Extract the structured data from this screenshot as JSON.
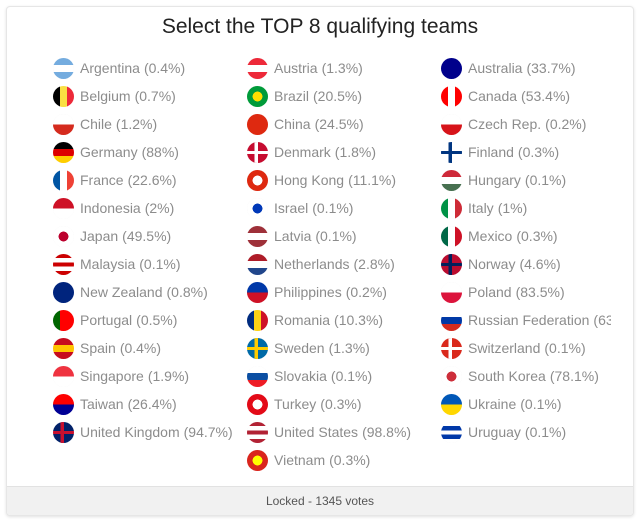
{
  "poll": {
    "title": "Select the TOP 8 qualifying teams",
    "footer": "Locked - 1345 votes"
  },
  "columns": [
    [
      {
        "name": "Argentina",
        "pct": "(0.4%)",
        "icon": "flag-argentina",
        "colors": [
          "#74acdf",
          "#ffffff",
          "#74acdf"
        ],
        "layout": "h"
      },
      {
        "name": "Belgium",
        "pct": "(0.7%)",
        "icon": "flag-belgium",
        "colors": [
          "#000000",
          "#fae042",
          "#ed2939"
        ],
        "layout": "v"
      },
      {
        "name": "Chile",
        "pct": "(1.2%)",
        "icon": "flag-chile",
        "colors": [
          "#ffffff",
          "#d52b1e"
        ],
        "layout": "h2"
      },
      {
        "name": "Germany",
        "pct": "(88%)",
        "icon": "flag-germany",
        "colors": [
          "#000000",
          "#dd0000",
          "#ffce00"
        ],
        "layout": "h"
      },
      {
        "name": "France",
        "pct": "(22.6%)",
        "icon": "flag-france",
        "colors": [
          "#0055a4",
          "#ffffff",
          "#ef4135"
        ],
        "layout": "v"
      },
      {
        "name": "Indonesia",
        "pct": "(2%)",
        "icon": "flag-indonesia",
        "colors": [
          "#ce1126",
          "#ffffff"
        ],
        "layout": "h2"
      },
      {
        "name": "Japan",
        "pct": "(49.5%)",
        "icon": "flag-japan",
        "colors": [
          "#ffffff",
          "#bc002d"
        ],
        "layout": "dot"
      },
      {
        "name": "Malaysia",
        "pct": "(0.1%)",
        "icon": "flag-malaysia",
        "colors": [
          "#cc0001",
          "#ffffff",
          "#cc0001",
          "#ffffff",
          "#cc0001"
        ],
        "layout": "h"
      },
      {
        "name": "New Zealand",
        "pct": "(0.8%)",
        "icon": "flag-new-zealand",
        "colors": [
          "#00247d",
          "#00247d"
        ],
        "layout": "h2"
      },
      {
        "name": "Portugal",
        "pct": "(0.5%)",
        "icon": "flag-portugal",
        "colors": [
          "#006600",
          "#ff0000",
          "#ff0000"
        ],
        "layout": "v"
      },
      {
        "name": "Spain",
        "pct": "(0.4%)",
        "icon": "flag-spain",
        "colors": [
          "#c60b1e",
          "#ffc400",
          "#c60b1e"
        ],
        "layout": "h"
      },
      {
        "name": "Singapore",
        "pct": "(1.9%)",
        "icon": "flag-singapore",
        "colors": [
          "#ef3340",
          "#ffffff"
        ],
        "layout": "h2"
      },
      {
        "name": "Taiwan",
        "pct": "(26.4%)",
        "icon": "flag-taiwan",
        "colors": [
          "#fe0000",
          "#000095"
        ],
        "layout": "h2"
      },
      {
        "name": "United Kingdom",
        "pct": "(94.7%)",
        "icon": "flag-united-kingdom",
        "colors": [
          "#012169",
          "#c8102e",
          "#012169"
        ],
        "layout": "cross"
      }
    ],
    [
      {
        "name": "Austria",
        "pct": "(1.3%)",
        "icon": "flag-austria",
        "colors": [
          "#ed2939",
          "#ffffff",
          "#ed2939"
        ],
        "layout": "h"
      },
      {
        "name": "Brazil",
        "pct": "(20.5%)",
        "icon": "flag-brazil",
        "colors": [
          "#009b3a",
          "#fedf00"
        ],
        "layout": "dot"
      },
      {
        "name": "China",
        "pct": "(24.5%)",
        "icon": "flag-china",
        "colors": [
          "#de2910",
          "#de2910"
        ],
        "layout": "h2"
      },
      {
        "name": "Denmark",
        "pct": "(1.8%)",
        "icon": "flag-denmark",
        "colors": [
          "#c60c30",
          "#ffffff"
        ],
        "layout": "cross"
      },
      {
        "name": "Hong Kong",
        "pct": "(11.1%)",
        "icon": "flag-hong-kong",
        "colors": [
          "#de2910",
          "#ffffff"
        ],
        "layout": "dot"
      },
      {
        "name": "Israel",
        "pct": "(0.1%)",
        "icon": "flag-israel",
        "colors": [
          "#ffffff",
          "#0038b8"
        ],
        "layout": "dot"
      },
      {
        "name": "Latvia",
        "pct": "(0.1%)",
        "icon": "flag-latvia",
        "colors": [
          "#9e3039",
          "#ffffff",
          "#9e3039"
        ],
        "layout": "h"
      },
      {
        "name": "Netherlands",
        "pct": "(2.8%)",
        "icon": "flag-netherlands",
        "colors": [
          "#ae1c28",
          "#ffffff",
          "#21468b"
        ],
        "layout": "h"
      },
      {
        "name": "Philippines",
        "pct": "(0.2%)",
        "icon": "flag-philippines",
        "colors": [
          "#0038a8",
          "#ce1126"
        ],
        "layout": "h2"
      },
      {
        "name": "Romania",
        "pct": "(10.3%)",
        "icon": "flag-romania",
        "colors": [
          "#002b7f",
          "#fcd116",
          "#ce1126"
        ],
        "layout": "v"
      },
      {
        "name": "Sweden",
        "pct": "(1.3%)",
        "icon": "flag-sweden",
        "colors": [
          "#006aa7",
          "#fecc00"
        ],
        "layout": "cross"
      },
      {
        "name": "Slovakia",
        "pct": "(0.1%)",
        "icon": "flag-slovakia",
        "colors": [
          "#ffffff",
          "#0b4ea2",
          "#ee1c25"
        ],
        "layout": "h"
      },
      {
        "name": "Turkey",
        "pct": "(0.3%)",
        "icon": "flag-turkey",
        "colors": [
          "#e30a17",
          "#ffffff"
        ],
        "layout": "dot"
      },
      {
        "name": "United States",
        "pct": "(98.8%)",
        "icon": "flag-united-states",
        "colors": [
          "#b22234",
          "#ffffff",
          "#b22234",
          "#ffffff",
          "#b22234"
        ],
        "layout": "h"
      },
      {
        "name": "Vietnam",
        "pct": "(0.3%)",
        "icon": "flag-vietnam",
        "colors": [
          "#da251d",
          "#ffff00"
        ],
        "layout": "dot"
      }
    ],
    [
      {
        "name": "Australia",
        "pct": "(33.7%)",
        "icon": "flag-australia",
        "colors": [
          "#00008b",
          "#00008b"
        ],
        "layout": "h2"
      },
      {
        "name": "Canada",
        "pct": "(53.4%)",
        "icon": "flag-canada",
        "colors": [
          "#ff0000",
          "#ffffff",
          "#ff0000"
        ],
        "layout": "v"
      },
      {
        "name": "Czech Rep.",
        "pct": "(0.2%)",
        "icon": "flag-czech-republic",
        "colors": [
          "#ffffff",
          "#d7141a"
        ],
        "layout": "h2"
      },
      {
        "name": "Finland",
        "pct": "(0.3%)",
        "icon": "flag-finland",
        "colors": [
          "#ffffff",
          "#003580"
        ],
        "layout": "cross"
      },
      {
        "name": "Hungary",
        "pct": "(0.1%)",
        "icon": "flag-hungary",
        "colors": [
          "#ce2939",
          "#ffffff",
          "#477050"
        ],
        "layout": "h"
      },
      {
        "name": "Italy",
        "pct": "(1%)",
        "icon": "flag-italy",
        "colors": [
          "#009246",
          "#ffffff",
          "#ce2b37"
        ],
        "layout": "v"
      },
      {
        "name": "Mexico",
        "pct": "(0.3%)",
        "icon": "flag-mexico",
        "colors": [
          "#006847",
          "#ffffff",
          "#ce1126"
        ],
        "layout": "v"
      },
      {
        "name": "Norway",
        "pct": "(4.6%)",
        "icon": "flag-norway",
        "colors": [
          "#ba0c2f",
          "#00205b"
        ],
        "layout": "cross"
      },
      {
        "name": "Poland",
        "pct": "(83.5%)",
        "icon": "flag-poland",
        "colors": [
          "#ffffff",
          "#dc143c"
        ],
        "layout": "h2"
      },
      {
        "name": "Russian Federation",
        "pct": "(63",
        "icon": "flag-russia",
        "colors": [
          "#ffffff",
          "#0039a6",
          "#d52b1e"
        ],
        "layout": "h"
      },
      {
        "name": "Switzerland",
        "pct": "(0.1%)",
        "icon": "flag-switzerland",
        "colors": [
          "#da291c",
          "#ffffff"
        ],
        "layout": "cross"
      },
      {
        "name": "South Korea",
        "pct": "(78.1%)",
        "icon": "flag-south-korea",
        "colors": [
          "#ffffff",
          "#cd2e3a"
        ],
        "layout": "dot"
      },
      {
        "name": "Ukraine",
        "pct": "(0.1%)",
        "icon": "flag-ukraine",
        "colors": [
          "#0057b7",
          "#ffd700"
        ],
        "layout": "h2"
      },
      {
        "name": "Uruguay",
        "pct": "(0.1%)",
        "icon": "flag-uruguay",
        "colors": [
          "#ffffff",
          "#0038a8",
          "#ffffff",
          "#0038a8",
          "#ffffff"
        ],
        "layout": "h"
      }
    ]
  ]
}
